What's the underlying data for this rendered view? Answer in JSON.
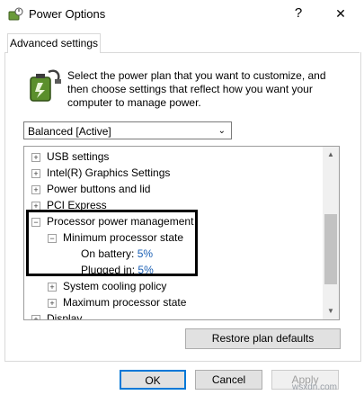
{
  "window": {
    "title": "Power Options",
    "help_label": "?",
    "close_label": "✕"
  },
  "tabs": [
    {
      "label": "Advanced settings"
    }
  ],
  "description": "Select the power plan that you want to customize, and then choose settings that reflect how you want your computer to manage power.",
  "plan_select": {
    "value": "Balanced [Active]"
  },
  "tree": {
    "items": [
      {
        "label": "USB settings",
        "expander": "+"
      },
      {
        "label": "Intel(R) Graphics Settings",
        "expander": "+"
      },
      {
        "label": "Power buttons and lid",
        "expander": "+"
      },
      {
        "label": "PCI Express",
        "expander": "+"
      },
      {
        "label": "Processor power management",
        "expander": "−"
      },
      {
        "label": "Minimum processor state",
        "expander": "−"
      },
      {
        "label": "On battery:",
        "value": "5%"
      },
      {
        "label": "Plugged in:",
        "value": "5%"
      },
      {
        "label": "System cooling policy",
        "expander": "+"
      },
      {
        "label": "Maximum processor state",
        "expander": "+"
      },
      {
        "label": "Display",
        "expander": "+"
      }
    ]
  },
  "buttons": {
    "restore": "Restore plan defaults",
    "ok": "OK",
    "cancel": "Cancel",
    "apply": "Apply"
  },
  "watermark": "wsxdn.com",
  "colors": {
    "link": "#1a5fb4",
    "ok_border": "#0078d7"
  }
}
